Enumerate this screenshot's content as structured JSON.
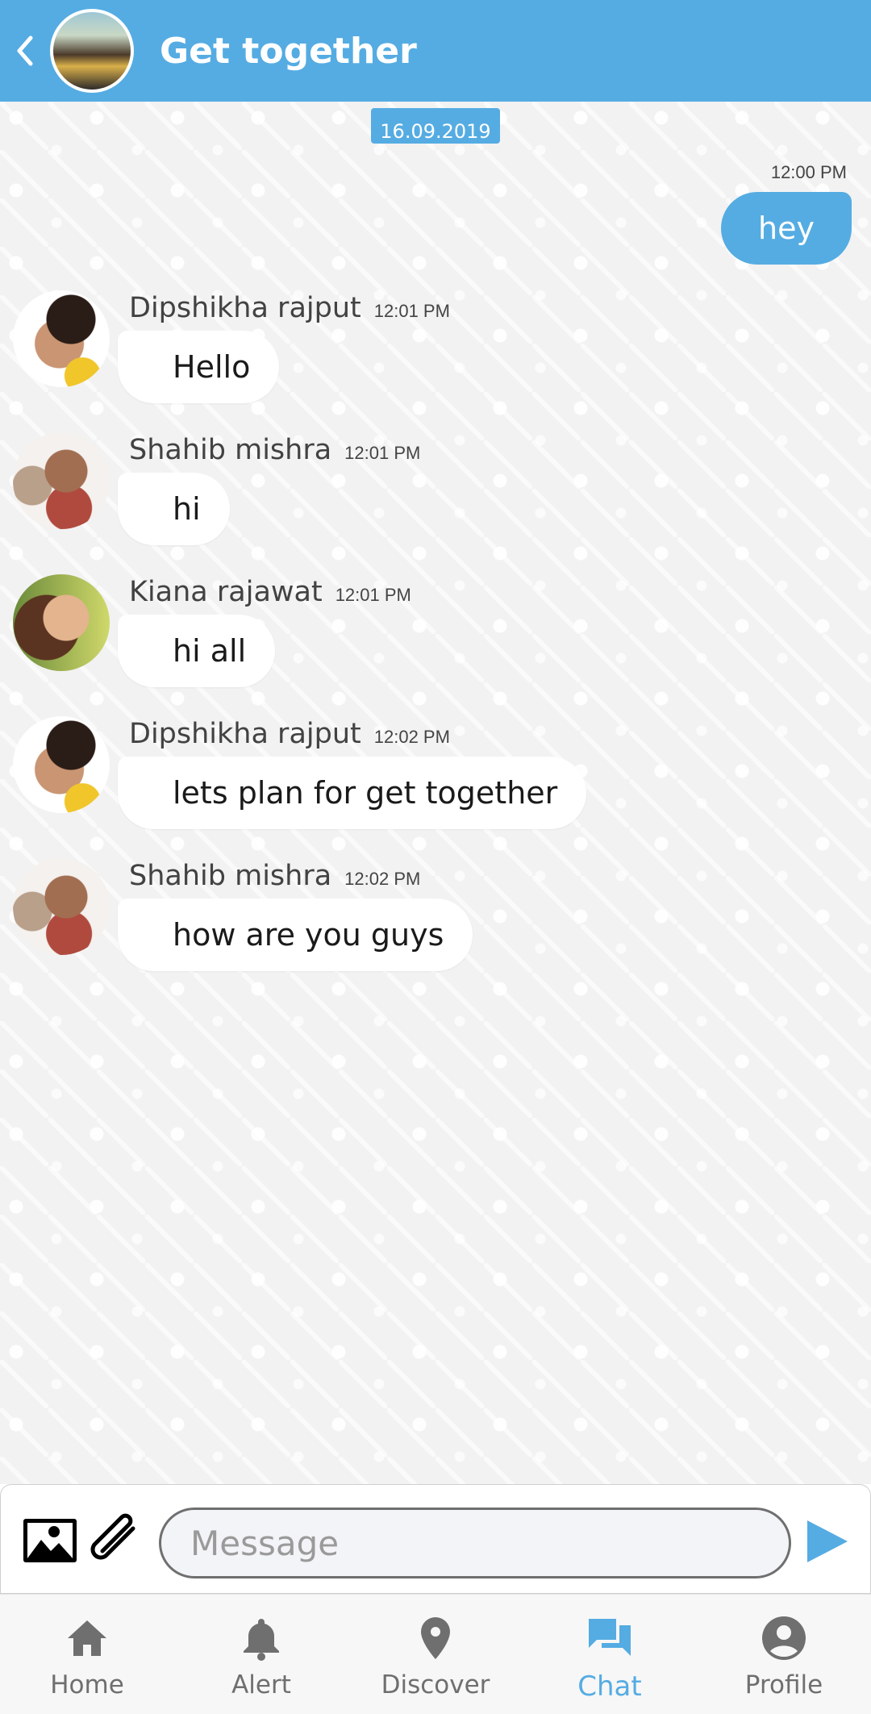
{
  "header": {
    "title": "Get together"
  },
  "chat": {
    "date_chip": "16.09.2019",
    "my_message": {
      "time": "12:00 PM",
      "text": "hey"
    },
    "messages": [
      {
        "sender": "Dipshikha rajput",
        "time": "12:01 PM",
        "text": "Hello"
      },
      {
        "sender": "Shahib mishra",
        "time": "12:01 PM",
        "text": "hi"
      },
      {
        "sender": "Kiana rajawat",
        "time": "12:01 PM",
        "text": "hi all"
      },
      {
        "sender": "Dipshikha rajput",
        "time": "12:02 PM",
        "text": "lets plan for get together"
      },
      {
        "sender": "Shahib mishra",
        "time": "12:02 PM",
        "text": "how are you guys"
      }
    ]
  },
  "composer": {
    "placeholder": "Message"
  },
  "nav": {
    "items": [
      {
        "label": "Home",
        "icon": "home-icon"
      },
      {
        "label": "Alert",
        "icon": "bell-icon"
      },
      {
        "label": "Discover",
        "icon": "location-pin-icon"
      },
      {
        "label": "Chat",
        "icon": "chat-icon"
      },
      {
        "label": "Profile",
        "icon": "profile-icon"
      }
    ],
    "active": "Chat"
  },
  "colors": {
    "accent": "#55ace2",
    "chat_bg": "#f2f2f2"
  }
}
